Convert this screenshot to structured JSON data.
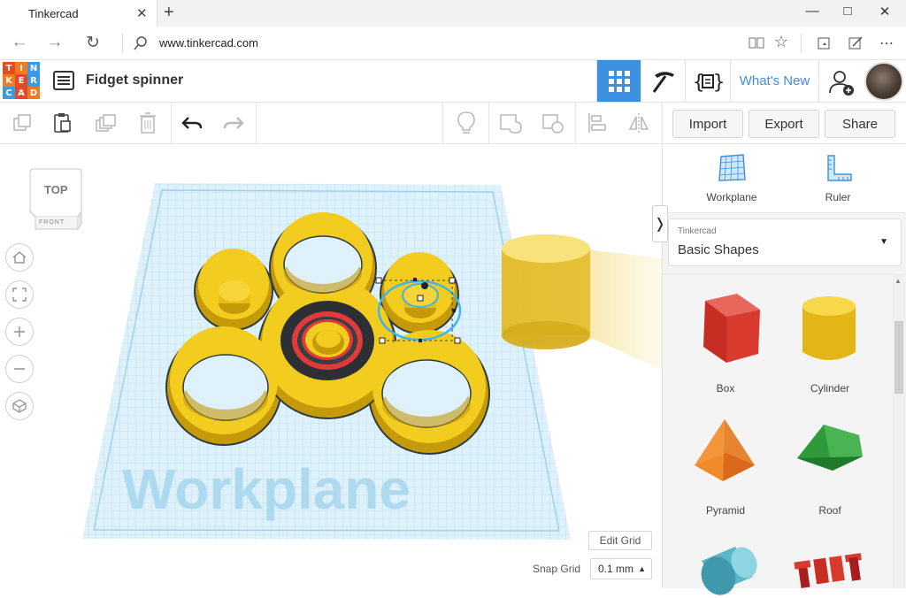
{
  "browser": {
    "tab_title": "Tinkercad",
    "tab_close": "✕",
    "new_tab": "+",
    "url": "www.tinkercad.com",
    "icons": [
      "back-icon",
      "forward-icon",
      "refresh-icon",
      "search-icon",
      "reading-view-icon",
      "favorite-icon",
      "favorites-hub-icon",
      "web-note-icon",
      "more-icon"
    ]
  },
  "app": {
    "logo_letters": [
      "T",
      "I",
      "N",
      "K",
      "E",
      "R",
      "C",
      "A",
      "D"
    ],
    "logo_colors": [
      "#e24b2a",
      "#f47a1f",
      "#3a9be2",
      "#f47a1f",
      "#e24b2a",
      "#3a9be2",
      "#3a9be2",
      "#e24b2a",
      "#f47a1f"
    ],
    "design_title": "Fidget spinner",
    "whats_new": "What's New",
    "accent": "#3d8fe0"
  },
  "toolbar": {
    "import": "Import",
    "export": "Export",
    "share": "Share"
  },
  "workspace": {
    "viewcube_top": "TOP",
    "viewcube_front": "FRONT",
    "workplane_watermark": "Workplane",
    "edit_grid": "Edit Grid",
    "snap_grid_label": "Snap Grid",
    "snap_grid_value": "0.1 mm",
    "collapse_glyph": "❭"
  },
  "panel": {
    "workplane_label": "Workplane",
    "ruler_label": "Ruler",
    "library_small": "Tinkercad",
    "library_name": "Basic Shapes",
    "shapes": [
      {
        "name": "Box",
        "color": "#d83a2e"
      },
      {
        "name": "Cylinder",
        "color": "#f2c31a"
      },
      {
        "name": "Pyramid",
        "color": "#f07c1c"
      },
      {
        "name": "Roof",
        "color": "#3aa544"
      }
    ]
  }
}
